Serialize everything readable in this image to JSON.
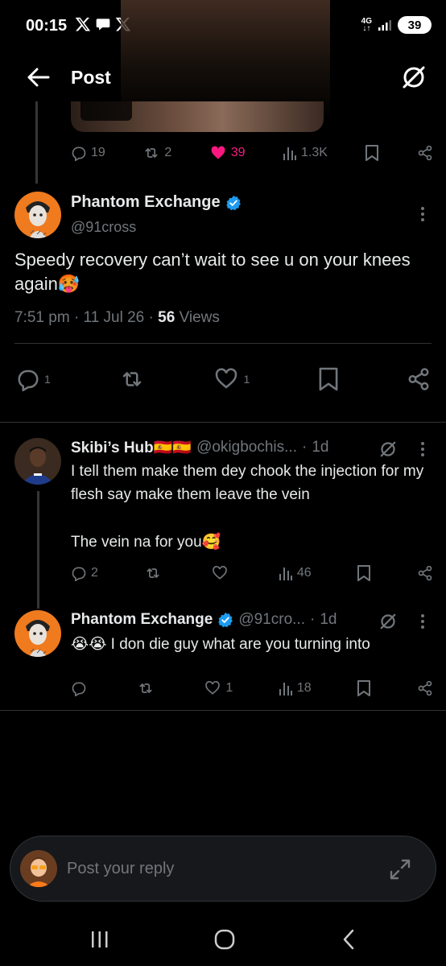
{
  "status_bar": {
    "time": "00:15",
    "network": "4G",
    "battery": "39"
  },
  "header": {
    "title": "Post"
  },
  "parent_post_actions": {
    "replies": "19",
    "reposts": "2",
    "likes": "39",
    "views": "1.3K"
  },
  "main_post": {
    "name": "Phantom Exchange",
    "handle": "@91cross",
    "text": "Speedy recovery can’t wait to see u on your knees again🥵",
    "time": "7:51 pm",
    "date": "11 Jul 26",
    "views_count": "56",
    "views_label": "Views",
    "replies": "1",
    "likes": "1"
  },
  "replies": [
    {
      "name": "Skibi’s Hub🇪🇸🇪🇸",
      "handle": "@okigbochis...",
      "age": "1d",
      "text_line1": "I tell them make them dey chook the injection for my flesh say make them leave the vein",
      "text_line2": "The vein na for you🥰",
      "replies": "2",
      "reposts": "",
      "likes": "",
      "views": "46"
    },
    {
      "name": "Phantom Exchange",
      "handle": "@91cro...",
      "age": "1d",
      "text_line1": "😭😭 I don die guy what are you turning into",
      "replies": "",
      "reposts": "",
      "likes": "1",
      "views": "18"
    }
  ],
  "reply_box": {
    "placeholder": "Post your reply"
  },
  "colors": {
    "background": "#000000",
    "text": "#e7e9ea",
    "muted": "#71767b",
    "like_pink": "#f91880",
    "verified_blue": "#1d9bf0"
  }
}
